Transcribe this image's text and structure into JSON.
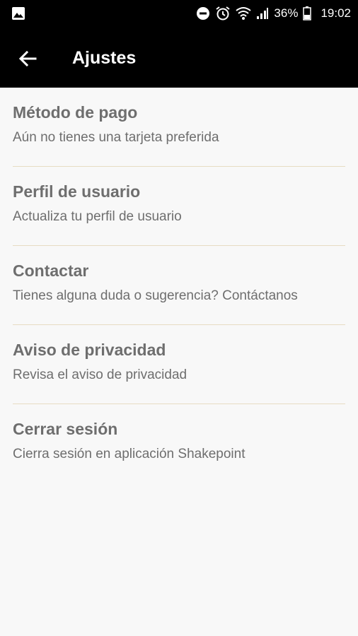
{
  "status_bar": {
    "battery": "36%",
    "time": "19:02"
  },
  "app_bar": {
    "title": "Ajustes"
  },
  "settings": [
    {
      "title": "Método de pago",
      "subtitle": "Aún no tienes una tarjeta preferida"
    },
    {
      "title": "Perfil de usuario",
      "subtitle": "Actualiza tu perfil de usuario"
    },
    {
      "title": "Contactar",
      "subtitle": "Tienes alguna duda o sugerencia? Contáctanos"
    },
    {
      "title": "Aviso de privacidad",
      "subtitle": "Revisa el aviso de privacidad"
    },
    {
      "title": "Cerrar sesión",
      "subtitle": "Cierra sesión en aplicación Shakepoint"
    }
  ],
  "colors": {
    "bar_background": "#000000",
    "page_background": "#f8f8f8",
    "text": "#6e6e6e",
    "divider": "#e7dcc3"
  },
  "icons": [
    "image-icon",
    "do-not-disturb-icon",
    "alarm-icon",
    "wifi-icon",
    "signal-icon",
    "battery-icon",
    "back-arrow-icon"
  ]
}
